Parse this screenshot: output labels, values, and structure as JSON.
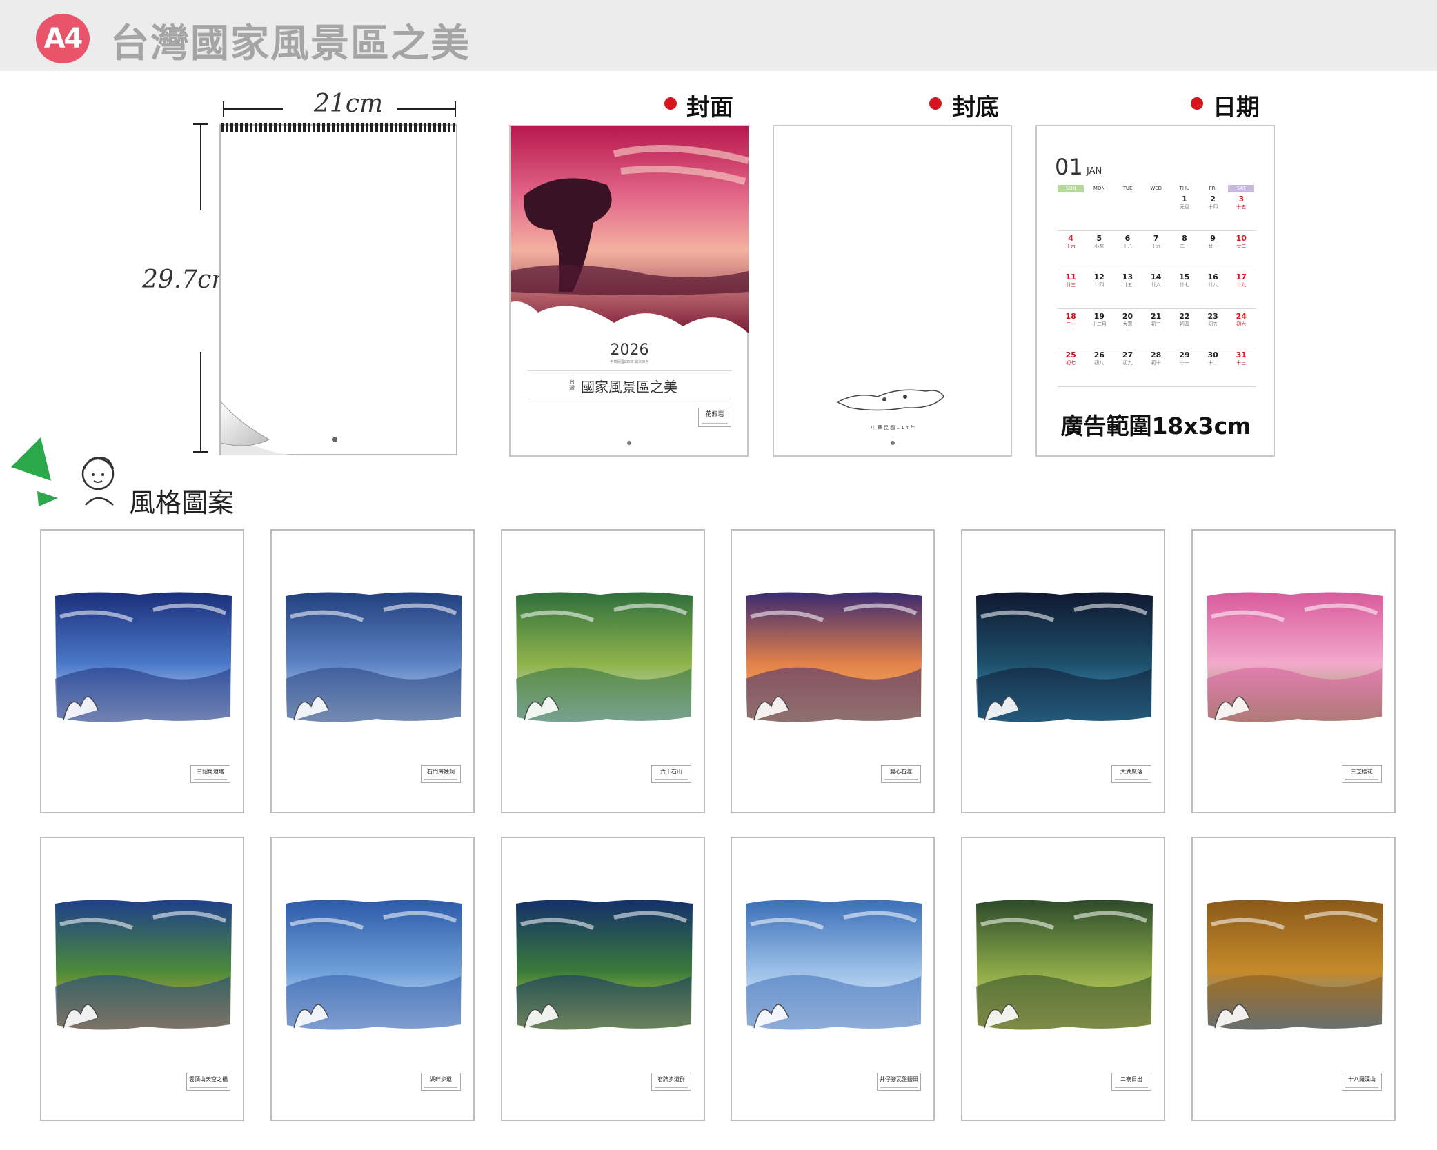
{
  "header": {
    "badge": "A4",
    "title": "台灣國家風景區之美"
  },
  "dimensions": {
    "width": "21cm",
    "height": "29.7cm"
  },
  "sections": {
    "cover": "封面",
    "back": "封底",
    "dates": "日期",
    "styles": "風格圖案"
  },
  "cover": {
    "year": "2026",
    "small_line": "中華民國115年 歲次丙午",
    "title_prefix": "台灣",
    "title": "國家風景區之美",
    "caption": "花瓶岩"
  },
  "back": {
    "footer": "中 華 民 國 1 1 4 年"
  },
  "calendar": {
    "month": "01",
    "month_name": "JAN",
    "weekdays": [
      "SUN",
      "MON",
      "TUE",
      "WED",
      "THU",
      "FRI",
      "SAT"
    ],
    "weeks": [
      [
        [
          "",
          ""
        ],
        [
          "",
          ""
        ],
        [
          "",
          ""
        ],
        [
          "",
          ""
        ],
        [
          "1",
          "元旦"
        ],
        [
          "2",
          "十四"
        ],
        [
          "3",
          "十五"
        ]
      ],
      [
        [
          "4",
          "十六"
        ],
        [
          "5",
          "小寒"
        ],
        [
          "6",
          "十八"
        ],
        [
          "7",
          "十九"
        ],
        [
          "8",
          "二十"
        ],
        [
          "9",
          "廿一"
        ],
        [
          "10",
          "廿二"
        ]
      ],
      [
        [
          "11",
          "廿三"
        ],
        [
          "12",
          "廿四"
        ],
        [
          "13",
          "廿五"
        ],
        [
          "14",
          "廿六"
        ],
        [
          "15",
          "廿七"
        ],
        [
          "16",
          "廿八"
        ],
        [
          "17",
          "廿九"
        ]
      ],
      [
        [
          "18",
          "三十"
        ],
        [
          "19",
          "十二月"
        ],
        [
          "20",
          "大寒"
        ],
        [
          "21",
          "初三"
        ],
        [
          "22",
          "初四"
        ],
        [
          "23",
          "初五"
        ],
        [
          "24",
          "初六"
        ]
      ],
      [
        [
          "25",
          "初七"
        ],
        [
          "26",
          "初八"
        ],
        [
          "27",
          "初九"
        ],
        [
          "28",
          "初十"
        ],
        [
          "29",
          "十一"
        ],
        [
          "30",
          "十二"
        ],
        [
          "31",
          "十三"
        ]
      ]
    ],
    "ad_text": "廣告範圍18x3cm"
  },
  "thumbnails": [
    {
      "caption": "三貂角燈塔",
      "palette": [
        "#1b2f7a",
        "#4a78c8",
        "#dce8f8"
      ]
    },
    {
      "caption": "石門海蝕洞",
      "palette": [
        "#22407e",
        "#5c82c4",
        "#d8e6f2"
      ]
    },
    {
      "caption": "六十石山",
      "palette": [
        "#2f6f3d",
        "#8fb34a",
        "#cfe0f5"
      ]
    },
    {
      "caption": "雙心石滬",
      "palette": [
        "#3a2a72",
        "#e3814a",
        "#f7c56a"
      ]
    },
    {
      "caption": "大湖聚落",
      "palette": [
        "#0f1830",
        "#1f4f6a",
        "#3fa8d8"
      ]
    },
    {
      "caption": "三芝櫻花",
      "palette": [
        "#d85a9c",
        "#f3a9cc",
        "#7ea34a"
      ]
    },
    {
      "caption": "雲頂山天空之橋",
      "palette": [
        "#1f3f8a",
        "#4d8a3a",
        "#f2b23a"
      ]
    },
    {
      "caption": "湖畔步道",
      "palette": [
        "#2d5aa8",
        "#6f9fd8",
        "#e3efff"
      ]
    },
    {
      "caption": "石牌步道群",
      "palette": [
        "#14306a",
        "#3a7a3a",
        "#d8e64a"
      ]
    },
    {
      "caption": "井仔腳瓦盤鹽田",
      "palette": [
        "#3c6fb8",
        "#9cc0e8",
        "#f2f6fb"
      ]
    },
    {
      "caption": "二寮日出",
      "palette": [
        "#2c4a2a",
        "#8aa848",
        "#e6d76a"
      ]
    },
    {
      "caption": "十八羅漢山",
      "palette": [
        "#8a5a1a",
        "#c58a2a",
        "#3f8ad8"
      ]
    }
  ]
}
